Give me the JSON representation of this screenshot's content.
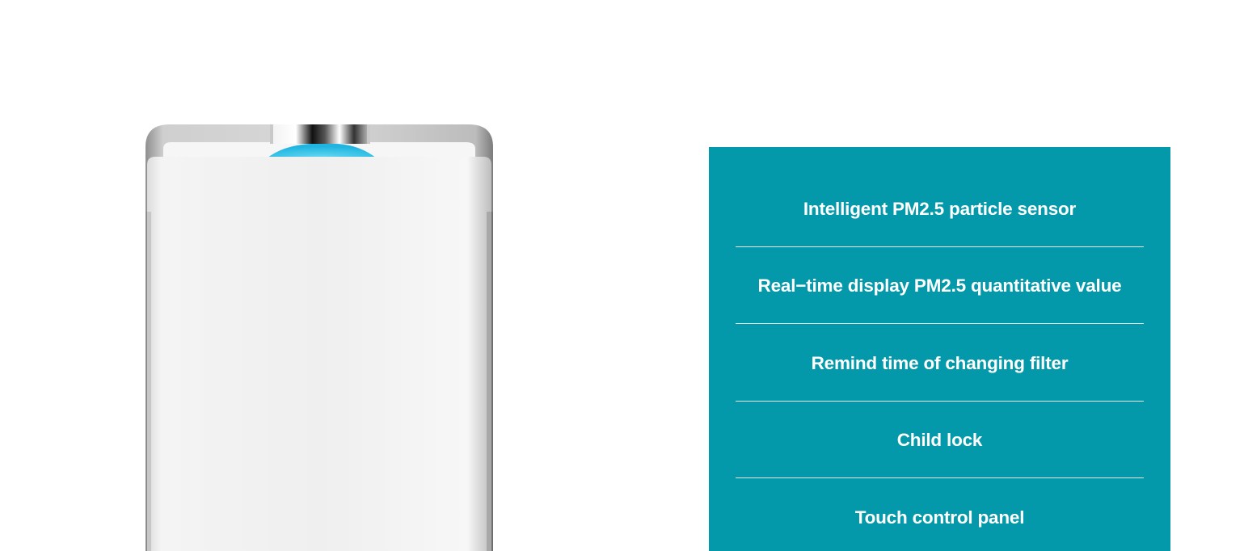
{
  "features": {
    "items": [
      {
        "label": "Intelligent PM2.5 particle sensor"
      },
      {
        "label": "Real−time display PM2.5 quantitative value"
      },
      {
        "label": "Remind time of changing filter"
      },
      {
        "label": "Child lock"
      },
      {
        "label": "Touch control panel"
      }
    ]
  },
  "colors": {
    "panel_background": "#0399aa",
    "panel_text": "#ffffff",
    "product_body": "#f1f1f1",
    "indicator_glow": "#2fc4e8"
  },
  "icons": {
    "product": "air-purifier-illustration"
  }
}
